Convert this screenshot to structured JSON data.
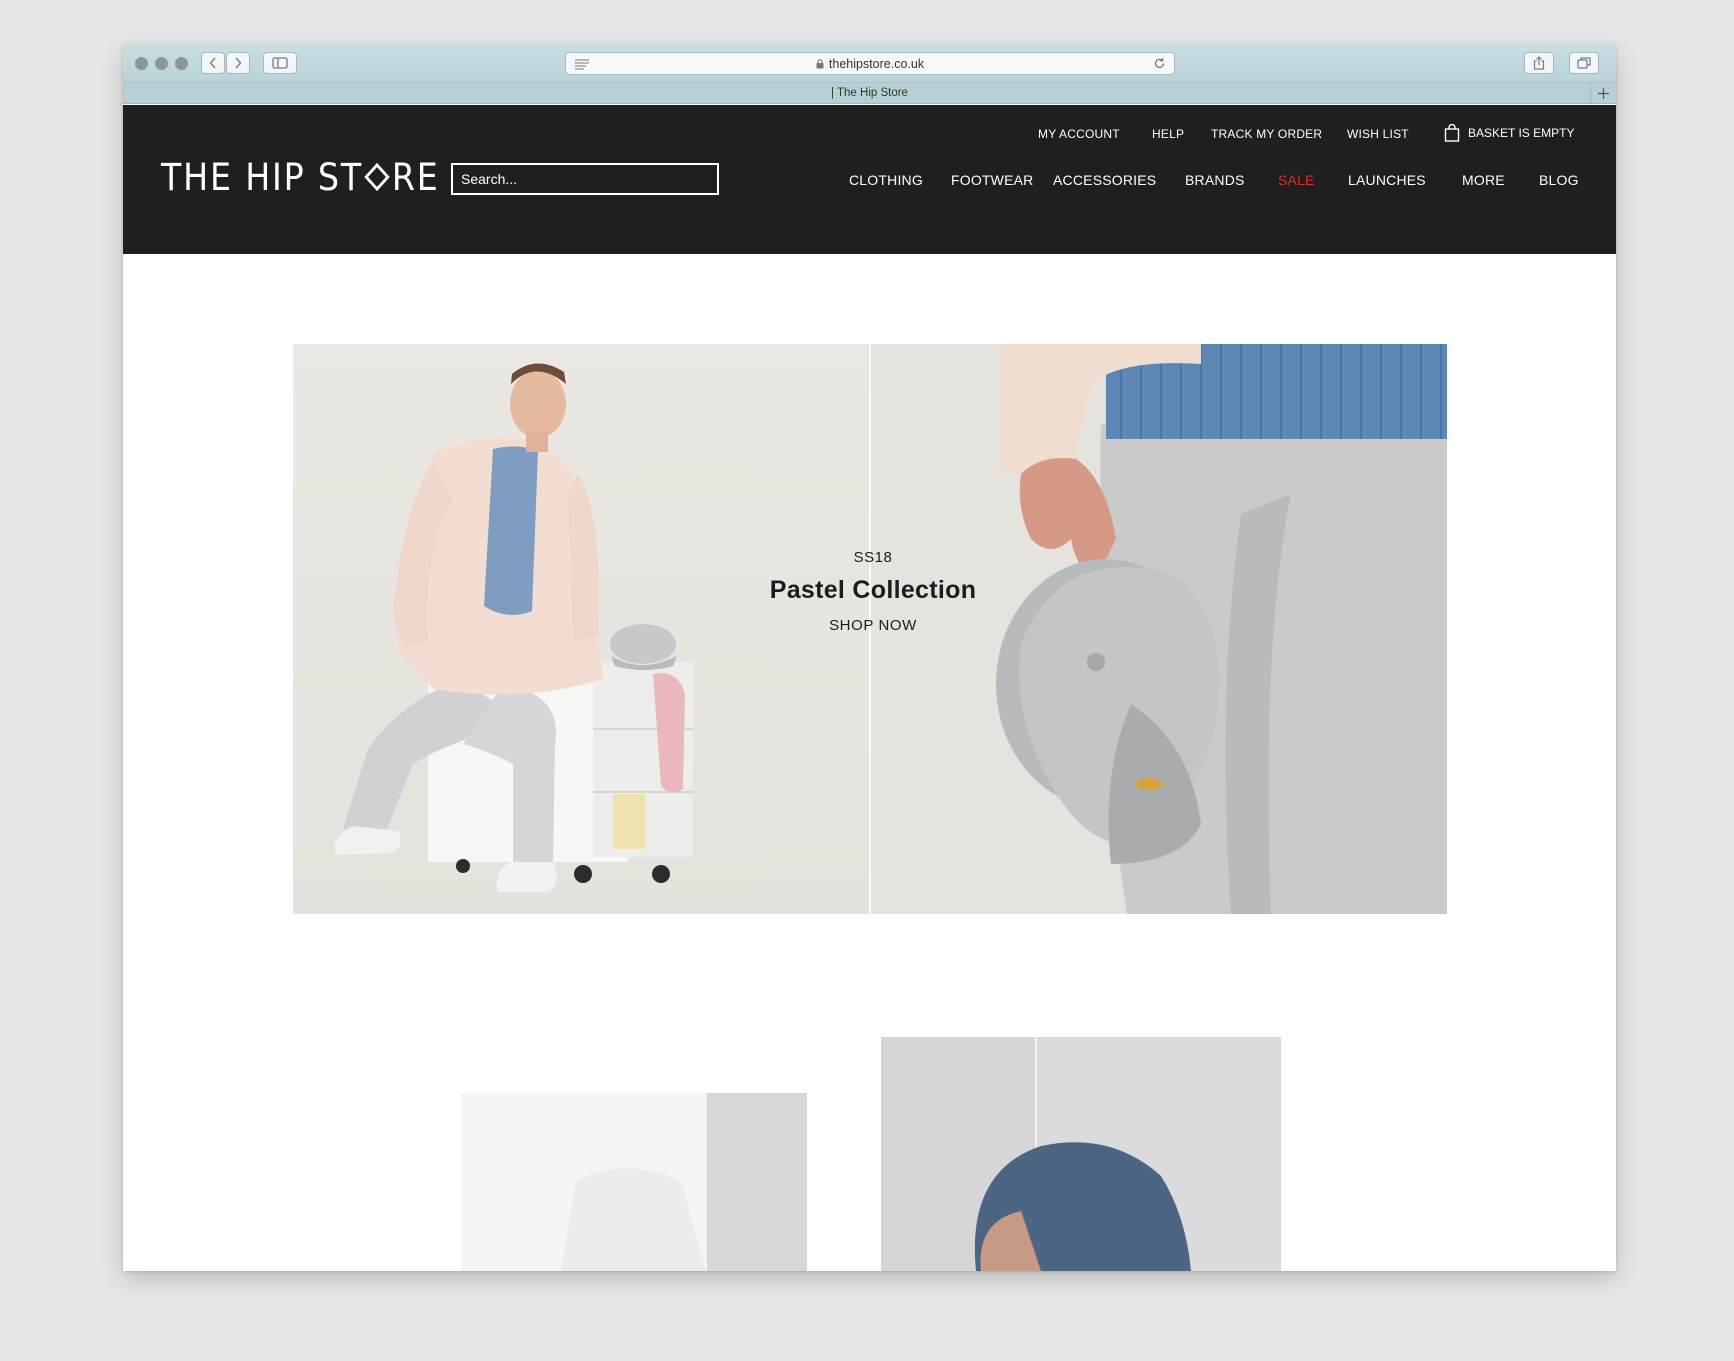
{
  "browser": {
    "url": "thehipstore.co.uk",
    "tab_title": "| The Hip Store",
    "icons": [
      "back-icon",
      "forward-icon",
      "sidebar-icon",
      "reader-icon",
      "lock-icon",
      "reload-icon",
      "share-icon",
      "tabs-icon",
      "plus-icon"
    ]
  },
  "header": {
    "logo": "THE HIP ST◆RE",
    "logo_parts": [
      "THE HIP ST",
      "RE"
    ],
    "search_placeholder": "Search...",
    "utility_links": [
      "MY ACCOUNT",
      "HELP",
      "TRACK MY ORDER",
      "WISH LIST"
    ],
    "basket_label": "BASKET IS EMPTY",
    "nav": [
      "CLOTHING",
      "FOOTWEAR",
      "ACCESSORIES",
      "BRANDS",
      "SALE",
      "LAUNCHES",
      "MORE",
      "BLOG"
    ],
    "sale_color": "#e8262c",
    "background": "#1f1f1f"
  },
  "hero": {
    "season": "SS18",
    "title": "Pastel Collection",
    "cta": "SHOP NOW"
  }
}
